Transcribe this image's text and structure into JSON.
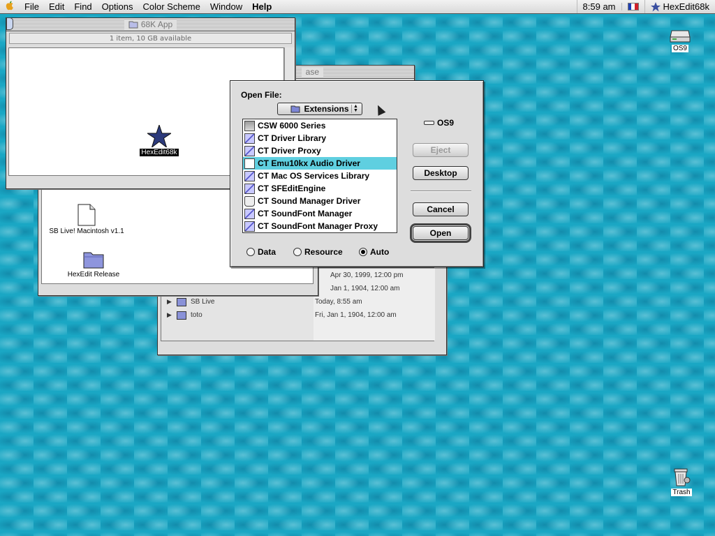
{
  "menubar": {
    "apple_glyph": "",
    "items": [
      "File",
      "Edit",
      "Find",
      "Options",
      "Color Scheme",
      "Window",
      "Help"
    ],
    "clock": "8:59 am",
    "app_name": "HexEdit68k",
    "flag_colors": [
      "#1d3fb5",
      "#ffffff",
      "#d0202a"
    ]
  },
  "window_68k": {
    "title": "68K App",
    "info": "1 item, 10 GB available",
    "icon_label": "HexEdit68k"
  },
  "window_release": {
    "title_fragment": "ase"
  },
  "window_sblive": {
    "icons": [
      {
        "label": "SB Live! Macintosh v1.1"
      },
      {
        "label": "HexEdit Release"
      }
    ]
  },
  "window_list": {
    "rows": [
      {
        "name": "",
        "date": "Apr 30, 1999, 12:00 pm"
      },
      {
        "name": "",
        "date": "Jan 1, 1904, 12:00 am"
      },
      {
        "name": "SB Live",
        "date": "Today, 8:55 am"
      },
      {
        "name": "toto",
        "date": "Fri, Jan 1, 1904, 12:00 am"
      }
    ]
  },
  "open_dialog": {
    "label": "Open File:",
    "location_popup": "Extensions",
    "volume": "OS9",
    "files": [
      {
        "name": "CSW 6000 Series",
        "icon": "printer-icon"
      },
      {
        "name": "CT Driver Library",
        "icon": "extension-icon"
      },
      {
        "name": "CT Driver Proxy",
        "icon": "extension-icon"
      },
      {
        "name": "CT Emu10kx Audio Driver",
        "icon": "document-icon",
        "selected": true
      },
      {
        "name": "CT Mac OS Services Library",
        "icon": "extension-icon"
      },
      {
        "name": "CT SFEditEngine",
        "icon": "extension-icon"
      },
      {
        "name": "CT Sound Manager Driver",
        "icon": "control-panel-icon"
      },
      {
        "name": "CT SoundFont Manager",
        "icon": "extension-icon"
      },
      {
        "name": "CT SoundFont Manager Proxy",
        "icon": "extension-icon"
      }
    ],
    "buttons": {
      "eject": "Eject",
      "desktop": "Desktop",
      "cancel": "Cancel",
      "open": "Open"
    },
    "radio": {
      "data": "Data",
      "resource": "Resource",
      "auto": "Auto",
      "selected": "Auto"
    }
  },
  "desktop": {
    "disk_label": "OS9",
    "trash_label": "Trash"
  }
}
